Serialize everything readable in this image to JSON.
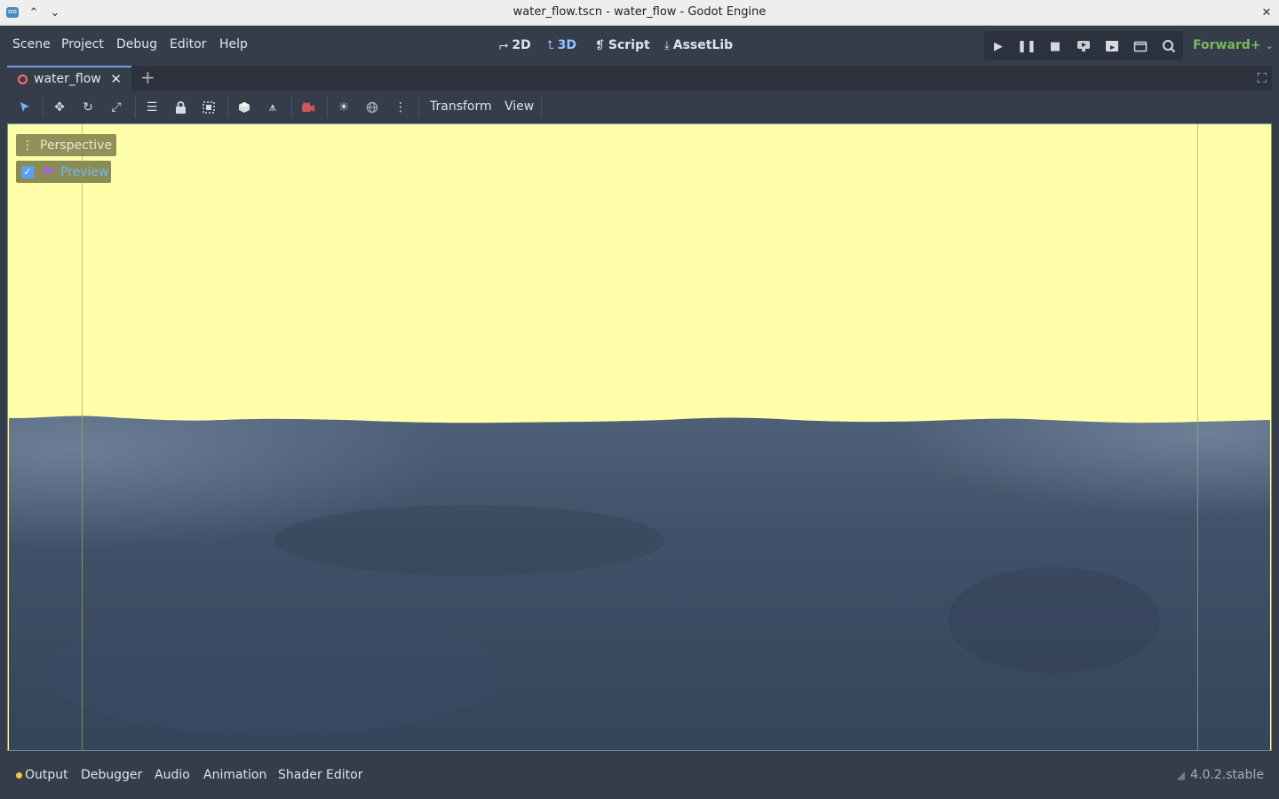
{
  "window": {
    "title": "water_flow.tscn - water_flow - Godot Engine"
  },
  "menu": {
    "items": [
      "Scene",
      "Project",
      "Debug",
      "Editor",
      "Help"
    ]
  },
  "workspaces": {
    "d2": "2D",
    "d3": "3D",
    "script": "Script",
    "assetlib": "AssetLib",
    "active": "3D"
  },
  "renderer": "Forward+",
  "scene_tab": {
    "name": "water_flow"
  },
  "toolbar": {
    "transform": "Transform",
    "view": "View"
  },
  "viewport": {
    "perspective_label": "Perspective",
    "preview_label": "Preview",
    "preview_checked": true,
    "sky_color": "#ffffaa",
    "water_color": "#3b4c66"
  },
  "bottom": {
    "tabs": [
      "Output",
      "Debugger",
      "Audio",
      "Animation",
      "Shader Editor"
    ],
    "version": "4.0.2.stable"
  }
}
